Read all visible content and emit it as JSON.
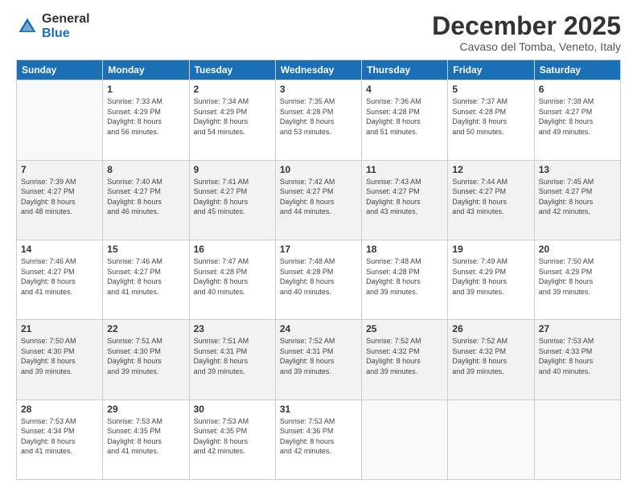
{
  "logo": {
    "general": "General",
    "blue": "Blue"
  },
  "header": {
    "month": "December 2025",
    "location": "Cavaso del Tomba, Veneto, Italy"
  },
  "weekdays": [
    "Sunday",
    "Monday",
    "Tuesday",
    "Wednesday",
    "Thursday",
    "Friday",
    "Saturday"
  ],
  "weeks": [
    [
      {
        "day": "",
        "info": ""
      },
      {
        "day": "1",
        "info": "Sunrise: 7:33 AM\nSunset: 4:29 PM\nDaylight: 8 hours\nand 56 minutes."
      },
      {
        "day": "2",
        "info": "Sunrise: 7:34 AM\nSunset: 4:29 PM\nDaylight: 8 hours\nand 54 minutes."
      },
      {
        "day": "3",
        "info": "Sunrise: 7:35 AM\nSunset: 4:28 PM\nDaylight: 8 hours\nand 53 minutes."
      },
      {
        "day": "4",
        "info": "Sunrise: 7:36 AM\nSunset: 4:28 PM\nDaylight: 8 hours\nand 51 minutes."
      },
      {
        "day": "5",
        "info": "Sunrise: 7:37 AM\nSunset: 4:28 PM\nDaylight: 8 hours\nand 50 minutes."
      },
      {
        "day": "6",
        "info": "Sunrise: 7:38 AM\nSunset: 4:27 PM\nDaylight: 8 hours\nand 49 minutes."
      }
    ],
    [
      {
        "day": "7",
        "info": "Sunrise: 7:39 AM\nSunset: 4:27 PM\nDaylight: 8 hours\nand 48 minutes."
      },
      {
        "day": "8",
        "info": "Sunrise: 7:40 AM\nSunset: 4:27 PM\nDaylight: 8 hours\nand 46 minutes."
      },
      {
        "day": "9",
        "info": "Sunrise: 7:41 AM\nSunset: 4:27 PM\nDaylight: 8 hours\nand 45 minutes."
      },
      {
        "day": "10",
        "info": "Sunrise: 7:42 AM\nSunset: 4:27 PM\nDaylight: 8 hours\nand 44 minutes."
      },
      {
        "day": "11",
        "info": "Sunrise: 7:43 AM\nSunset: 4:27 PM\nDaylight: 8 hours\nand 43 minutes."
      },
      {
        "day": "12",
        "info": "Sunrise: 7:44 AM\nSunset: 4:27 PM\nDaylight: 8 hours\nand 43 minutes."
      },
      {
        "day": "13",
        "info": "Sunrise: 7:45 AM\nSunset: 4:27 PM\nDaylight: 8 hours\nand 42 minutes."
      }
    ],
    [
      {
        "day": "14",
        "info": "Sunrise: 7:46 AM\nSunset: 4:27 PM\nDaylight: 8 hours\nand 41 minutes."
      },
      {
        "day": "15",
        "info": "Sunrise: 7:46 AM\nSunset: 4:27 PM\nDaylight: 8 hours\nand 41 minutes."
      },
      {
        "day": "16",
        "info": "Sunrise: 7:47 AM\nSunset: 4:28 PM\nDaylight: 8 hours\nand 40 minutes."
      },
      {
        "day": "17",
        "info": "Sunrise: 7:48 AM\nSunset: 4:28 PM\nDaylight: 8 hours\nand 40 minutes."
      },
      {
        "day": "18",
        "info": "Sunrise: 7:48 AM\nSunset: 4:28 PM\nDaylight: 8 hours\nand 39 minutes."
      },
      {
        "day": "19",
        "info": "Sunrise: 7:49 AM\nSunset: 4:29 PM\nDaylight: 8 hours\nand 39 minutes."
      },
      {
        "day": "20",
        "info": "Sunrise: 7:50 AM\nSunset: 4:29 PM\nDaylight: 8 hours\nand 39 minutes."
      }
    ],
    [
      {
        "day": "21",
        "info": "Sunrise: 7:50 AM\nSunset: 4:30 PM\nDaylight: 8 hours\nand 39 minutes."
      },
      {
        "day": "22",
        "info": "Sunrise: 7:51 AM\nSunset: 4:30 PM\nDaylight: 8 hours\nand 39 minutes."
      },
      {
        "day": "23",
        "info": "Sunrise: 7:51 AM\nSunset: 4:31 PM\nDaylight: 8 hours\nand 39 minutes."
      },
      {
        "day": "24",
        "info": "Sunrise: 7:52 AM\nSunset: 4:31 PM\nDaylight: 8 hours\nand 39 minutes."
      },
      {
        "day": "25",
        "info": "Sunrise: 7:52 AM\nSunset: 4:32 PM\nDaylight: 8 hours\nand 39 minutes."
      },
      {
        "day": "26",
        "info": "Sunrise: 7:52 AM\nSunset: 4:32 PM\nDaylight: 8 hours\nand 39 minutes."
      },
      {
        "day": "27",
        "info": "Sunrise: 7:53 AM\nSunset: 4:33 PM\nDaylight: 8 hours\nand 40 minutes."
      }
    ],
    [
      {
        "day": "28",
        "info": "Sunrise: 7:53 AM\nSunset: 4:34 PM\nDaylight: 8 hours\nand 41 minutes."
      },
      {
        "day": "29",
        "info": "Sunrise: 7:53 AM\nSunset: 4:35 PM\nDaylight: 8 hours\nand 41 minutes."
      },
      {
        "day": "30",
        "info": "Sunrise: 7:53 AM\nSunset: 4:35 PM\nDaylight: 8 hours\nand 42 minutes."
      },
      {
        "day": "31",
        "info": "Sunrise: 7:53 AM\nSunset: 4:36 PM\nDaylight: 8 hours\nand 42 minutes."
      },
      {
        "day": "",
        "info": ""
      },
      {
        "day": "",
        "info": ""
      },
      {
        "day": "",
        "info": ""
      }
    ]
  ]
}
